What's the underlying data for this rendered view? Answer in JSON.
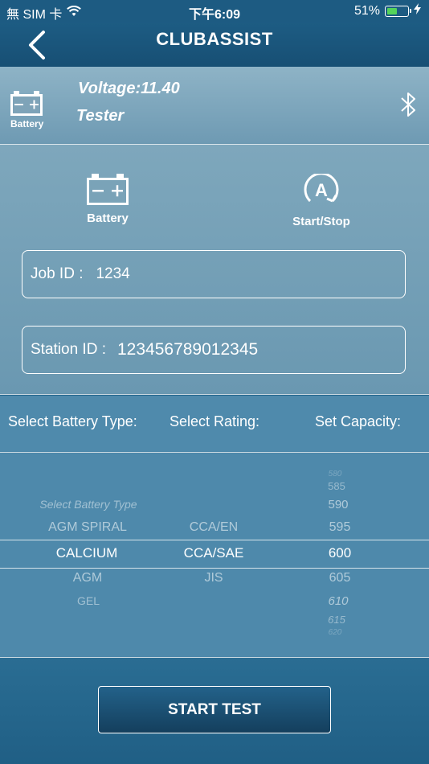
{
  "status_bar": {
    "carrier": "無 SIM 卡",
    "time": "下午6:09",
    "battery_percent": "51%",
    "battery_level": 0.51,
    "wifi_icon": "wifi-icon",
    "charging_icon": "bolt-icon"
  },
  "navbar": {
    "back_icon": "chevron-left-icon",
    "logo_text": "CLUBASSIST"
  },
  "device": {
    "icon_label": "Battery",
    "voltage": "Voltage:11.40",
    "tester": "Tester",
    "bluetooth_icon": "bluetooth-icon"
  },
  "modes": {
    "battery_label": "Battery",
    "start_stop_label": "Start/Stop"
  },
  "form": {
    "job_label": "Job ID :",
    "job_value": "1234",
    "station_label": "Station ID :",
    "station_value": "123456789012345"
  },
  "headers": {
    "battery_type": "Select Battery Type:",
    "rating": "Select Rating:",
    "capacity": "Set Capacity:"
  },
  "picker": {
    "battery_types": [
      "Select Battery Type",
      "AGM SPIRAL",
      "CALCIUM",
      "AGM",
      "GEL"
    ],
    "battery_selected": "CALCIUM",
    "ratings": [
      "CCA/EN",
      "CCA/SAE",
      "JIS"
    ],
    "rating_selected": "CCA/SAE",
    "capacities": [
      "580",
      "585",
      "590",
      "595",
      "600",
      "605",
      "610",
      "615",
      "620"
    ],
    "capacity_selected": "600"
  },
  "action": {
    "start_test_label": "START TEST"
  },
  "colors": {
    "header_bg": "#1d5c83",
    "panel_bg": "#7ea7bc",
    "picker_bg": "#4e89ab",
    "battery_green": "#54d35a"
  }
}
